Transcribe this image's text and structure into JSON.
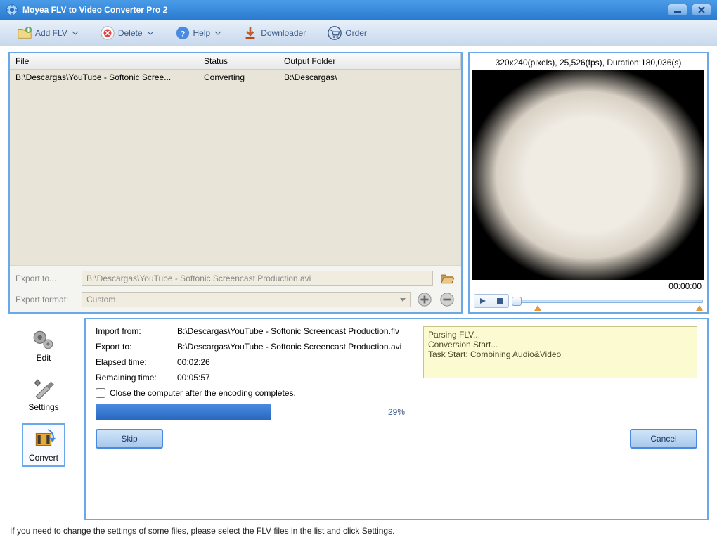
{
  "title": "Moyea FLV to Video Converter Pro 2",
  "toolbar": {
    "add": "Add FLV",
    "delete": "Delete",
    "help": "Help",
    "downloader": "Downloader",
    "order": "Order"
  },
  "filelist": {
    "headers": {
      "file": "File",
      "status": "Status",
      "output": "Output Folder"
    },
    "rows": [
      {
        "file": "B:\\Descargas\\YouTube - Softonic Scree...",
        "status": "Converting",
        "output": "B:\\Descargas\\"
      }
    ]
  },
  "export": {
    "to_label": "Export to...",
    "to_value": "B:\\Descargas\\YouTube - Softonic Screencast Production.avi",
    "format_label": "Export format:",
    "format_value": "Custom"
  },
  "preview": {
    "info": "320x240(pixels), 25,526(fps), Duration:180,036(s)",
    "time": "00:00:00"
  },
  "tools": {
    "edit": "Edit",
    "settings": "Settings",
    "convert": "Convert"
  },
  "progress": {
    "import_label": "Import from:",
    "import_value": "B:\\Descargas\\YouTube - Softonic Screencast Production.flv",
    "export_label": "Export to:",
    "export_value": "B:\\Descargas\\YouTube - Softonic Screencast Production.avi",
    "elapsed_label": "Elapsed time:",
    "elapsed_value": "00:02:26",
    "remaining_label": "Remaining time:",
    "remaining_value": "00:05:57",
    "checkbox_label": "Close the computer after the encoding completes.",
    "percent_text": "29%",
    "percent_value": 29,
    "log": {
      "l1": "Parsing FLV...",
      "l2": "Conversion Start...",
      "l3": "Task Start: Combining Audio&Video"
    },
    "skip": "Skip",
    "cancel": "Cancel"
  },
  "statusbar": "If you need to change the settings of some files, please select the FLV files in the list and click Settings."
}
